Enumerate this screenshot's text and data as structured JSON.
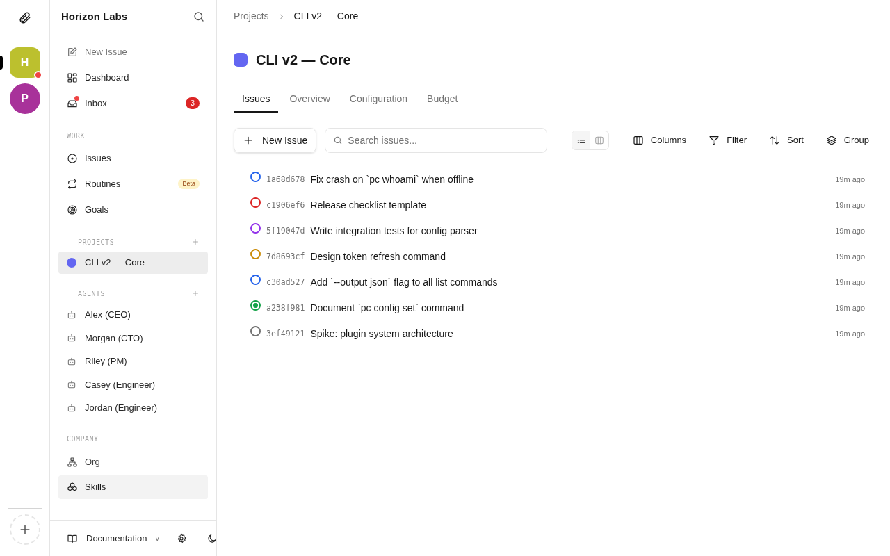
{
  "workspaces": [
    {
      "initial": "H",
      "color": "#bcc02e",
      "selected": true,
      "notification": true
    },
    {
      "initial": "P",
      "color": "#a8329a",
      "selected": false,
      "notification": false
    }
  ],
  "sidebar": {
    "company": "Horizon Labs",
    "top_items": [
      {
        "label": "New Issue",
        "muted": true
      },
      {
        "label": "Dashboard",
        "muted": false
      },
      {
        "label": "Inbox",
        "muted": false,
        "unread_dot": true,
        "count": "3"
      }
    ],
    "work": {
      "heading": "WORK",
      "items": [
        {
          "label": "Issues"
        },
        {
          "label": "Routines",
          "badge": "Beta"
        },
        {
          "label": "Goals"
        }
      ]
    },
    "projects": {
      "heading": "PROJECTS",
      "items": [
        {
          "label": "CLI v2 — Core",
          "color": "#6366f1",
          "selected": true
        }
      ]
    },
    "agents": {
      "heading": "AGENTS",
      "items": [
        {
          "label": "Alex (CEO)"
        },
        {
          "label": "Morgan (CTO)"
        },
        {
          "label": "Riley (PM)"
        },
        {
          "label": "Casey (Engineer)"
        },
        {
          "label": "Jordan (Engineer)"
        }
      ]
    },
    "company_section": {
      "heading": "COMPANY",
      "items": [
        {
          "label": "Org",
          "selected": false
        },
        {
          "label": "Skills",
          "selected": true
        }
      ]
    },
    "footer": {
      "documentation": "Documentation",
      "version": "v"
    }
  },
  "breadcrumbs": [
    {
      "label": "Projects",
      "current": false
    },
    {
      "label": "CLI v2 — Core",
      "current": true
    }
  ],
  "project": {
    "title": "CLI v2 — Core",
    "color": "#6366f1"
  },
  "tabs": [
    {
      "label": "Issues",
      "selected": true
    },
    {
      "label": "Overview",
      "selected": false
    },
    {
      "label": "Configuration",
      "selected": false
    },
    {
      "label": "Budget",
      "selected": false
    }
  ],
  "toolbar": {
    "new_issue": "New Issue",
    "search": {
      "placeholder": "Search issues..."
    },
    "views": [
      {
        "kind": "list",
        "selected": true
      },
      {
        "kind": "board",
        "selected": false
      }
    ],
    "actions": [
      {
        "label": "Columns"
      },
      {
        "label": "Filter"
      },
      {
        "label": "Sort"
      },
      {
        "label": "Group"
      }
    ]
  },
  "issues": [
    {
      "id": "1a68d678",
      "title": "Fix crash on `pc whoami` when offline",
      "time": "19m ago",
      "color": "#2563eb",
      "done": false
    },
    {
      "id": "c1906ef6",
      "title": "Release checklist template",
      "time": "19m ago",
      "color": "#dc2626",
      "done": false
    },
    {
      "id": "5f19047d",
      "title": "Write integration tests for config parser",
      "time": "19m ago",
      "color": "#9333ea",
      "done": false
    },
    {
      "id": "7d8693cf",
      "title": "Design token refresh command",
      "time": "19m ago",
      "color": "#ca8a04",
      "done": false
    },
    {
      "id": "c30ad527",
      "title": "Add `--output json` flag to all list commands",
      "time": "19m ago",
      "color": "#2563eb",
      "done": false
    },
    {
      "id": "a238f981",
      "title": "Document `pc config set` command",
      "time": "19m ago",
      "color": "#16a34a",
      "done": true
    },
    {
      "id": "3ef49121",
      "title": "Spike: plugin system architecture",
      "time": "19m ago",
      "color": "#737373",
      "done": false
    }
  ]
}
